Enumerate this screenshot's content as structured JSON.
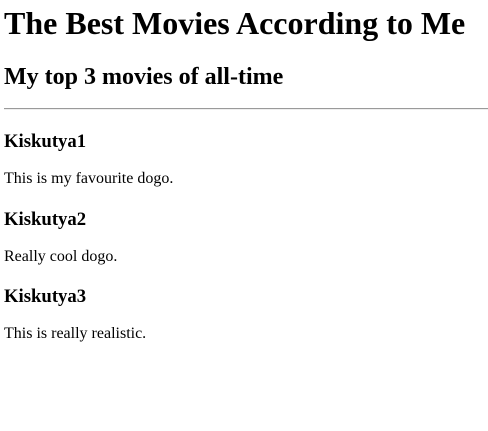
{
  "header": {
    "title": "The Best Movies According to Me",
    "subtitle": "My top 3 movies of all-time"
  },
  "movies": [
    {
      "title": "Kiskutya1",
      "description": "This is my favourite dogo."
    },
    {
      "title": "Kiskutya2",
      "description": "Really cool dogo."
    },
    {
      "title": "Kiskutya3",
      "description": "This is really realistic."
    }
  ]
}
